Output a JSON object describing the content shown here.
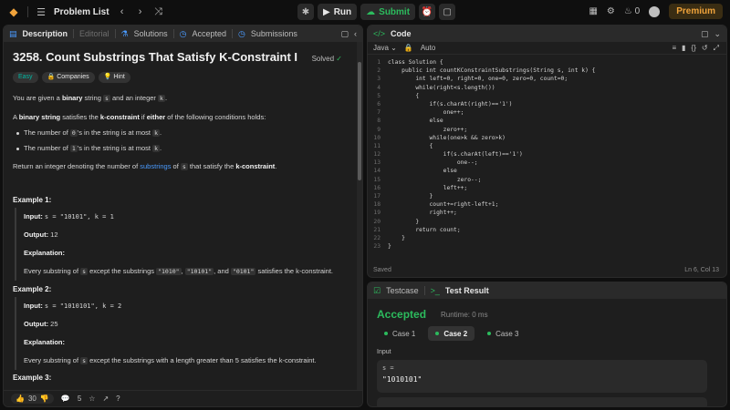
{
  "topbar": {
    "problem_list": "Problem List",
    "run": "Run",
    "submit": "Submit",
    "streak": "0",
    "premium": "Premium"
  },
  "desc": {
    "tabs": {
      "description": "Description",
      "editorial": "Editorial",
      "solutions": "Solutions",
      "accepted": "Accepted",
      "submissions": "Submissions"
    },
    "title": "3258. Count Substrings That Satisfy K-Constraint I",
    "solved": "Solved",
    "tags": {
      "easy": "Easy",
      "companies": "Companies",
      "hint": "Hint"
    },
    "p1": {
      "a": "You are given a ",
      "b": "binary",
      "c": " string ",
      "s": "s",
      "d": " and an integer ",
      "k": "k",
      "e": "."
    },
    "p2": {
      "a": "A ",
      "b": "binary string",
      "c": " satisfies the ",
      "d": "k-constraint",
      "e": " if ",
      "f": "either",
      "g": " of the following conditions holds:"
    },
    "bul1": {
      "a": "The number of ",
      "code": "0",
      "b": "'s in the string is at most ",
      "k": "k",
      "c": "."
    },
    "bul2": {
      "a": "The number of ",
      "code": "1",
      "b": "'s in the string is at most ",
      "k": "k",
      "c": "."
    },
    "p3": {
      "a": "Return an integer denoting the number of ",
      "link": "substrings",
      "b": " of ",
      "s": "s",
      "c": " that satisfy the ",
      "d": "k-constraint",
      "e": "."
    },
    "ex1": {
      "title": "Example 1:",
      "input_label": "Input:",
      "input": "s = \"10101\", k = 1",
      "output_label": "Output:",
      "output": "12",
      "expl_label": "Explanation:",
      "expl": {
        "a": "Every substring of ",
        "s": "s",
        "b": " except the substrings ",
        "c1": "\"1010\"",
        "comma1": ", ",
        "c2": "\"10101\"",
        "comma2": ", and ",
        "c3": "\"0101\"",
        "d": " satisfies the k-constraint."
      }
    },
    "ex2": {
      "title": "Example 2:",
      "input_label": "Input:",
      "input": "s = \"1010101\", k = 2",
      "output_label": "Output:",
      "output": "25",
      "expl_label": "Explanation:",
      "expl": {
        "a": "Every substring of ",
        "s": "s",
        "b": " except the substrings with a length greater than 5 satisfies the k-constraint."
      }
    },
    "ex3": {
      "title": "Example 3:"
    },
    "footer": {
      "likes": "30",
      "comments": "5"
    }
  },
  "code": {
    "tab": "Code",
    "language": "Java",
    "auto": "Auto",
    "lines": [
      "class Solution {",
      "    public int countKConstraintSubstrings(String s, int k) {",
      "        int left=0, right=0, one=0, zero=0, count=0;",
      "        while(right<s.length())",
      "        {",
      "            if(s.charAt(right)=='1')",
      "                one++;",
      "            else",
      "                zero++;",
      "            while(one>k && zero>k)",
      "            {",
      "                if(s.charAt(left)=='1')",
      "                    one--;",
      "                else",
      "                    zero--;",
      "                left++;",
      "            }",
      "            count+=right-left+1;",
      "            right++;",
      "        }",
      "        return count;",
      "    }",
      "}"
    ],
    "status": "Saved",
    "position": "Ln 6, Col 13"
  },
  "test": {
    "tab_testcase": "Testcase",
    "tab_result": "Test Result",
    "accepted": "Accepted",
    "runtime": "Runtime: 0 ms",
    "cases": [
      "Case 1",
      "Case 2",
      "Case 3"
    ],
    "input_label": "Input",
    "var": "s =",
    "value": "\"1010101\""
  },
  "colors": {
    "accent_green": "#2cbb5d",
    "accent_orange": "#f0a33b",
    "accent_blue": "#4a9bff"
  }
}
